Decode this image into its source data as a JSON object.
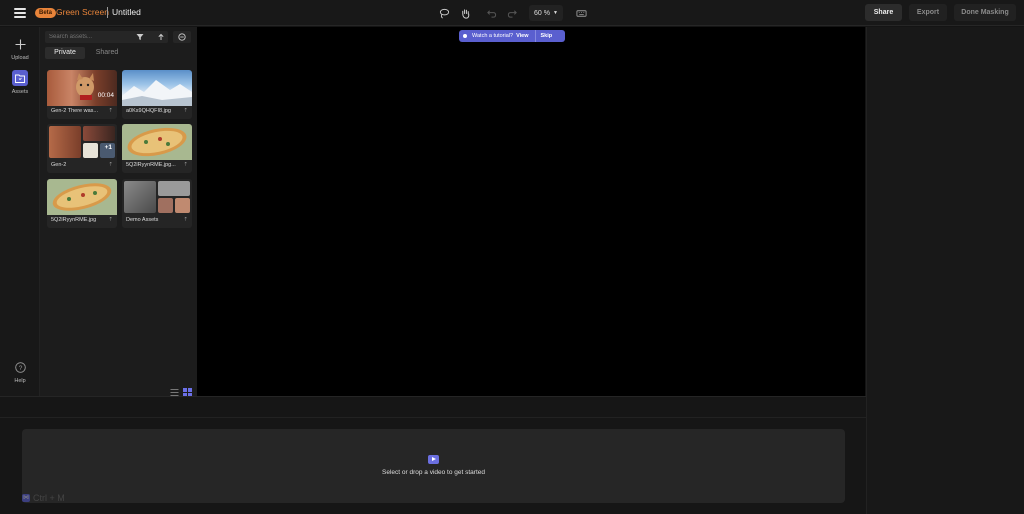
{
  "topbar": {
    "badge": "Beta",
    "product": "Green Screen",
    "title": "Untitled",
    "zoom": "60 %",
    "share": "Share",
    "export": "Export",
    "done": "Done Masking"
  },
  "rail": {
    "upload": "Upload",
    "assets": "Assets",
    "help": "Help"
  },
  "panel": {
    "search_placeholder": "Search assets...",
    "tabs": [
      "Private",
      "Shared"
    ],
    "assets": [
      {
        "name": "Gen-2 There was...",
        "duration": "00:04"
      },
      {
        "name": "a0Ks9QHQFI8.jpg"
      },
      {
        "name": "Gen-2",
        "extra": "+1"
      },
      {
        "name": "5Q2lRyynRME.jpg..."
      },
      {
        "name": "5Q2lRyynRME.jpg"
      },
      {
        "name": "Demo Assets"
      }
    ]
  },
  "canvas": {
    "tutorial_text": "Watch a tutorial?",
    "tutorial_view": "View",
    "tutorial_skip": "Skip"
  },
  "timeline": {
    "drop_text": "Select or drop a video to get started",
    "shortcut": "Ctrl + M"
  },
  "colors": {
    "accent": "#5a5fcf",
    "brand": "#e8843a"
  }
}
